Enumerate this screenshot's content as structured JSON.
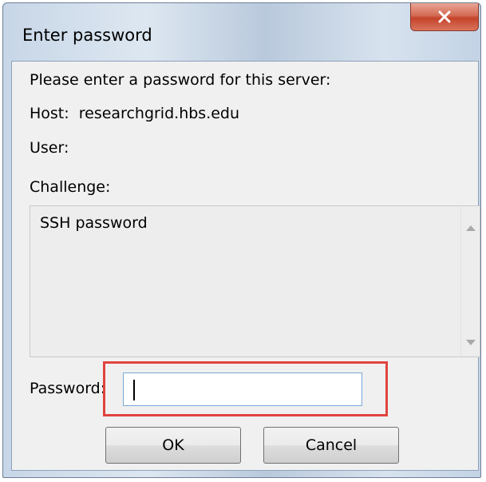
{
  "window": {
    "title": "Enter password",
    "close_glyph": "X"
  },
  "dialog": {
    "prompt": "Please enter a password for this server:",
    "host": "Host:  researchgrid.hbs.edu",
    "user": "User:",
    "challenge_label": "Challenge:",
    "challenge_text": "SSH password",
    "password_label": "Password:",
    "password_value": ""
  },
  "buttons": {
    "ok": "OK",
    "cancel": "Cancel"
  },
  "colors": {
    "highlight": "#e0443f",
    "close_button": "#c5432a"
  }
}
